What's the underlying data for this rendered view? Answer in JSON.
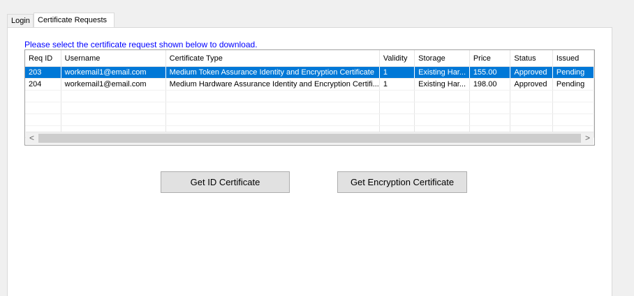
{
  "tabs": [
    {
      "label": "Login"
    },
    {
      "label": "Certificate Requests"
    }
  ],
  "prompt": "Please select the certificate request shown below to download.",
  "columns": [
    "Req ID",
    "Username",
    "Certificate Type",
    "Validity",
    "Storage",
    "Price",
    "Status",
    "Issued"
  ],
  "rows": [
    {
      "req_id": "203",
      "username": "workemail1@email.com",
      "cert_type": "Medium Token Assurance Identity and Encryption Certificate",
      "validity": "1",
      "storage": "Existing Har...",
      "price": "155.00",
      "status": "Approved",
      "issued": "Pending"
    },
    {
      "req_id": "204",
      "username": "workemail1@email.com",
      "cert_type": "Medium Hardware Assurance Identity and Encryption Certifi...",
      "validity": "1",
      "storage": "Existing Har...",
      "price": "198.00",
      "status": "Approved",
      "issued": "Pending"
    }
  ],
  "scroll": {
    "left_arrow": "<",
    "right_arrow": ">"
  },
  "buttons": {
    "id_cert": "Get ID Certificate",
    "enc_cert": "Get Encryption Certificate"
  }
}
